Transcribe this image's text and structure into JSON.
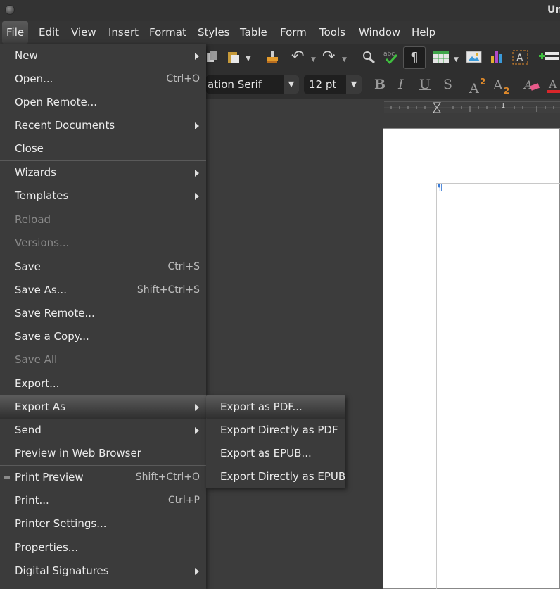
{
  "window": {
    "title_visible": "Un"
  },
  "menubar": [
    "File",
    "Edit",
    "View",
    "Insert",
    "Format",
    "Styles",
    "Table",
    "Form",
    "Tools",
    "Window",
    "Help"
  ],
  "toolbar": {
    "font_name": "ation Serif",
    "font_size": "12 pt"
  },
  "file_menu": {
    "new": {
      "label": "New"
    },
    "open": {
      "label": "Open...",
      "shortcut": "Ctrl+O"
    },
    "open_remote": {
      "label": "Open Remote..."
    },
    "recent": {
      "label": "Recent Documents"
    },
    "close": {
      "label": "Close"
    },
    "wizards": {
      "label": "Wizards"
    },
    "templates": {
      "label": "Templates"
    },
    "reload": {
      "label": "Reload"
    },
    "versions": {
      "label": "Versions..."
    },
    "save": {
      "label": "Save",
      "shortcut": "Ctrl+S"
    },
    "save_as": {
      "label": "Save As...",
      "shortcut": "Shift+Ctrl+S"
    },
    "save_remote": {
      "label": "Save Remote..."
    },
    "save_copy": {
      "label": "Save a Copy..."
    },
    "save_all": {
      "label": "Save All"
    },
    "export": {
      "label": "Export..."
    },
    "export_as": {
      "label": "Export As"
    },
    "send": {
      "label": "Send"
    },
    "preview_web": {
      "label": "Preview in Web Browser"
    },
    "print_preview": {
      "label": "Print Preview",
      "shortcut": "Shift+Ctrl+O"
    },
    "print": {
      "label": "Print...",
      "shortcut": "Ctrl+P"
    },
    "printer_settings": {
      "label": "Printer Settings..."
    },
    "properties": {
      "label": "Properties..."
    },
    "digital_signatures": {
      "label": "Digital Signatures"
    }
  },
  "export_as_submenu": [
    "Export as PDF...",
    "Export Directly as PDF",
    "Export as EPUB...",
    "Export Directly as EPUB"
  ],
  "ruler": {
    "mark": "1"
  },
  "document": {
    "pilcrow": "¶"
  }
}
